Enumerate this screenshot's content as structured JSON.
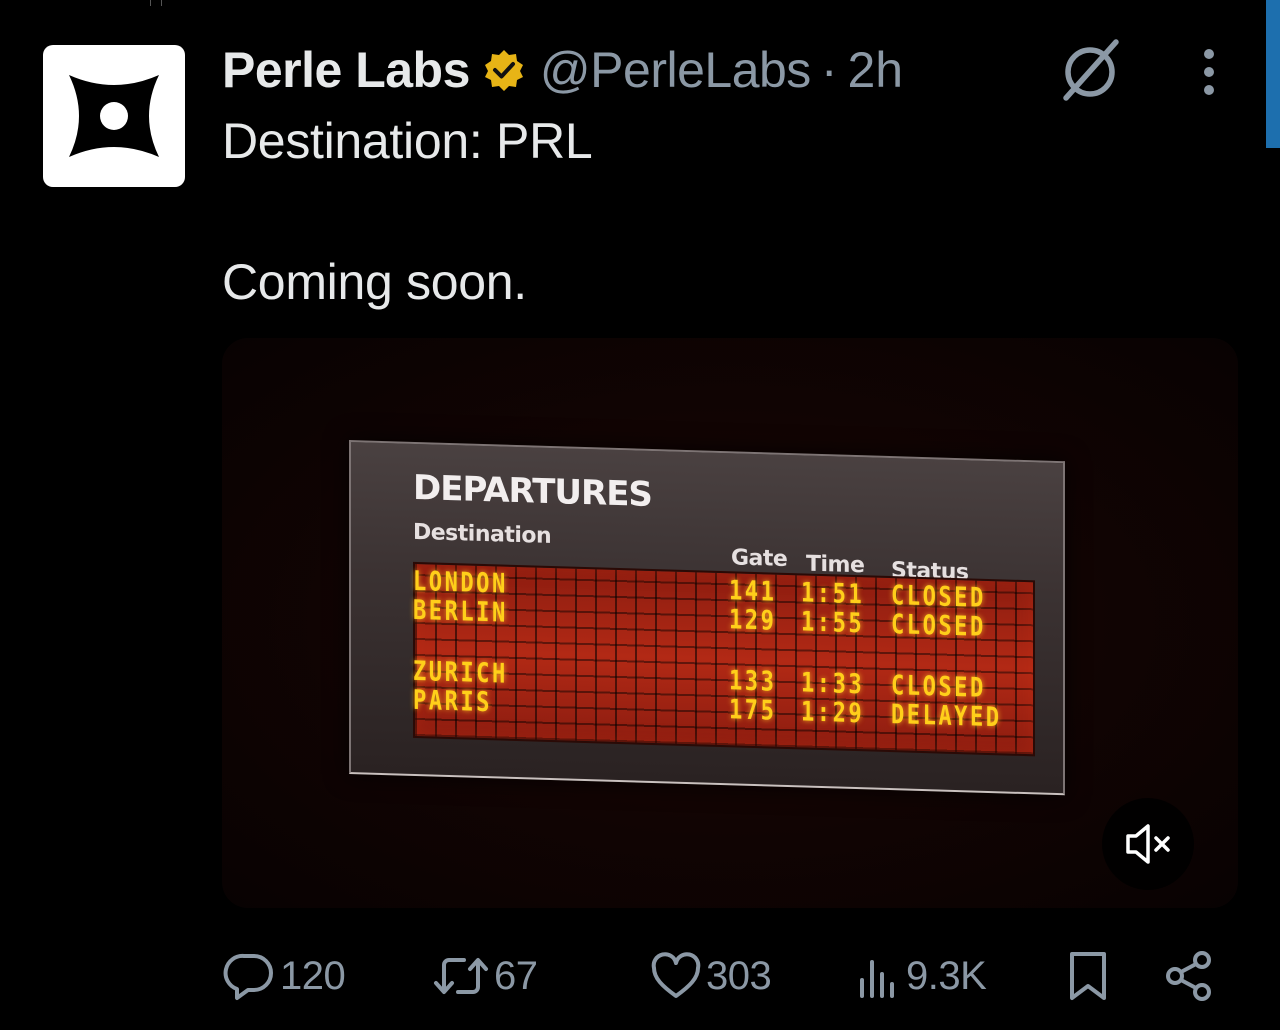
{
  "author": {
    "display_name": "Perle Labs",
    "handle": "@PerleLabs",
    "separator": "·",
    "time_ago": "2h",
    "verified": true,
    "badge_color": "#e7b416"
  },
  "tweet": {
    "line1": "Destination: PRL",
    "line2": "Coming soon."
  },
  "media": {
    "board_title": "DEPARTURES",
    "headers": {
      "destination": "Destination",
      "gate": "Gate",
      "time": "Time",
      "status": "Status"
    },
    "rows": [
      {
        "destination": "LONDON",
        "gate": "141",
        "time": "1:51",
        "status": "CLOSED"
      },
      {
        "destination": "BERLIN",
        "gate": "129",
        "time": "1:55",
        "status": "CLOSED"
      },
      {
        "destination": "ZURICH",
        "gate": "133",
        "time": "1:33",
        "status": "CLOSED"
      },
      {
        "destination": "PARIS",
        "gate": "175",
        "time": "1:29",
        "status": "DELAYED"
      }
    ],
    "flap_text_color": "#ffcf1a",
    "flap_panel_color": "#b22915",
    "mute_icon": "speaker-muted-icon"
  },
  "actions": {
    "replies": "120",
    "reposts": "67",
    "likes": "303",
    "views": "9.3K"
  },
  "icons": {
    "reply": "reply-icon",
    "repost": "repost-icon",
    "like": "heart-icon",
    "views": "views-icon",
    "bookmark": "bookmark-icon",
    "share": "share-icon",
    "grok": "grok-icon",
    "more": "more-icon"
  }
}
